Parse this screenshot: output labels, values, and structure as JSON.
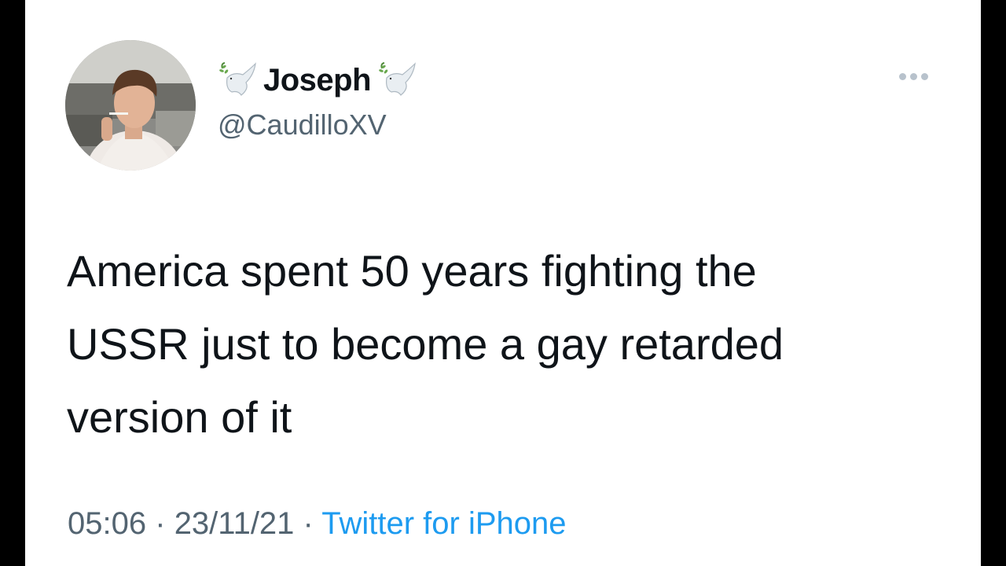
{
  "tweet": {
    "author": {
      "display_name": "Joseph",
      "handle": "@CaudilloXV",
      "avatar_icon": "profile-photo",
      "name_emoji_icon": "dove-icon"
    },
    "menu_icon": "more-options-icon",
    "text_lines": [
      "America spent 50 years fighting the",
      "USSR just to become a gay retarded",
      "version of it"
    ],
    "time": "05:06",
    "separator": "·",
    "date": "23/11/21",
    "source": "Twitter for iPhone"
  },
  "colors": {
    "text_primary": "#0f1419",
    "text_secondary": "#536471",
    "link": "#1d9bf0",
    "background": "#ffffff",
    "frame": "#000000"
  }
}
